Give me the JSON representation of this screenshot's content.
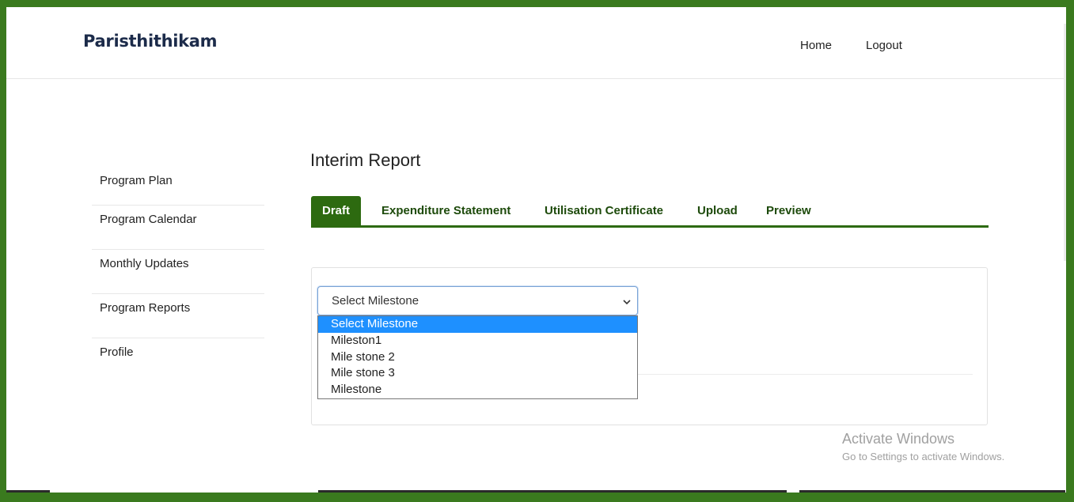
{
  "header": {
    "brand": "Paristhithikam",
    "nav": {
      "home": "Home",
      "logout": "Logout"
    }
  },
  "sidebar": {
    "items": [
      {
        "label": "Program Plan"
      },
      {
        "label": "Program Calendar"
      },
      {
        "label": "Monthly Updates"
      },
      {
        "label": "Program Reports"
      },
      {
        "label": "Profile"
      }
    ]
  },
  "main": {
    "title": "Interim Report",
    "tabs": [
      {
        "label": "Draft",
        "active": true
      },
      {
        "label": "Expenditure Statement",
        "active": false
      },
      {
        "label": "Utilisation Certificate",
        "active": false
      },
      {
        "label": "Upload",
        "active": false
      },
      {
        "label": "Preview",
        "active": false
      }
    ],
    "milestone_select": {
      "value": "Select Milestone",
      "options": [
        "Select Milestone",
        "Mileston1",
        "Mile stone 2",
        "Mile stone 3",
        "Milestone"
      ],
      "highlighted": "Select Milestone"
    }
  },
  "watermark": {
    "title": "Activate Windows",
    "subtitle": "Go to Settings to activate Windows."
  },
  "colors": {
    "brand_green": "#2d6a10",
    "frame_green": "#3a7a1e",
    "option_highlight": "#1e90ff"
  }
}
